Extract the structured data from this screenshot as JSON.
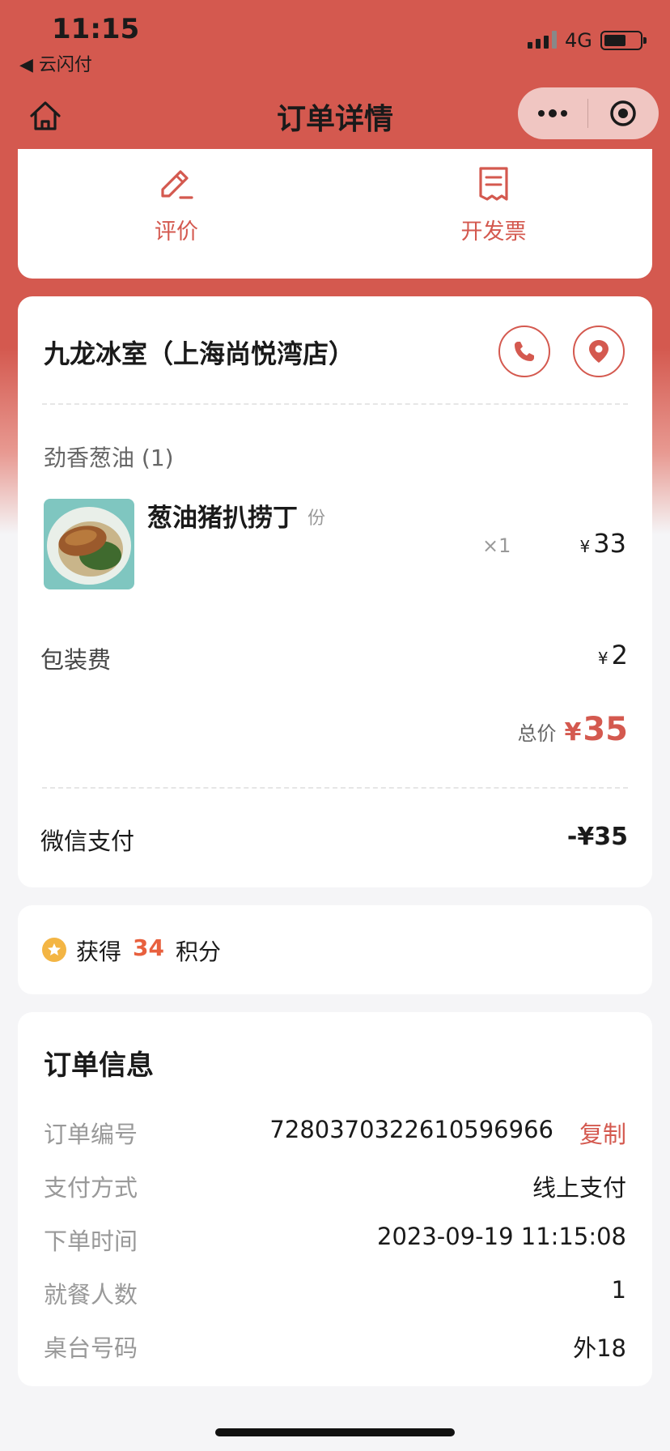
{
  "status_bar": {
    "time": "11:15",
    "back_app": "◀ 云闪付",
    "network": "4G"
  },
  "nav": {
    "title": "订单详情"
  },
  "actions": {
    "review_label": "评价",
    "invoice_label": "开发票"
  },
  "store": {
    "name": "九龙冰室（上海尚悦湾店）"
  },
  "order": {
    "group_title": "劲香葱油 (1)",
    "items": [
      {
        "name": "葱油猪扒捞丁",
        "unit": "份",
        "qty": "×1",
        "currency": "¥",
        "price": "33"
      }
    ],
    "fee_label": "包装费",
    "fee_currency": "¥",
    "fee_value": "2",
    "total_label": "总价",
    "total_currency": "¥",
    "total_value": "35",
    "payment_label": "微信支付",
    "payment_value": "-¥35"
  },
  "points": {
    "prefix": "获得",
    "value": "34",
    "suffix": "积分"
  },
  "info": {
    "title": "订单信息",
    "order_no_label": "订单编号",
    "order_no": "7280370322610596966",
    "copy_label": "复制",
    "pay_method_label": "支付方式",
    "pay_method": "线上支付",
    "order_time_label": "下单时间",
    "order_time": "2023-09-19 11:15:08",
    "diners_label": "就餐人数",
    "diners": "1",
    "table_label": "桌台号码",
    "table": "外18"
  },
  "colors": {
    "brand": "#d4594f",
    "points_accent": "#e8603e",
    "star": "#f3b544"
  }
}
